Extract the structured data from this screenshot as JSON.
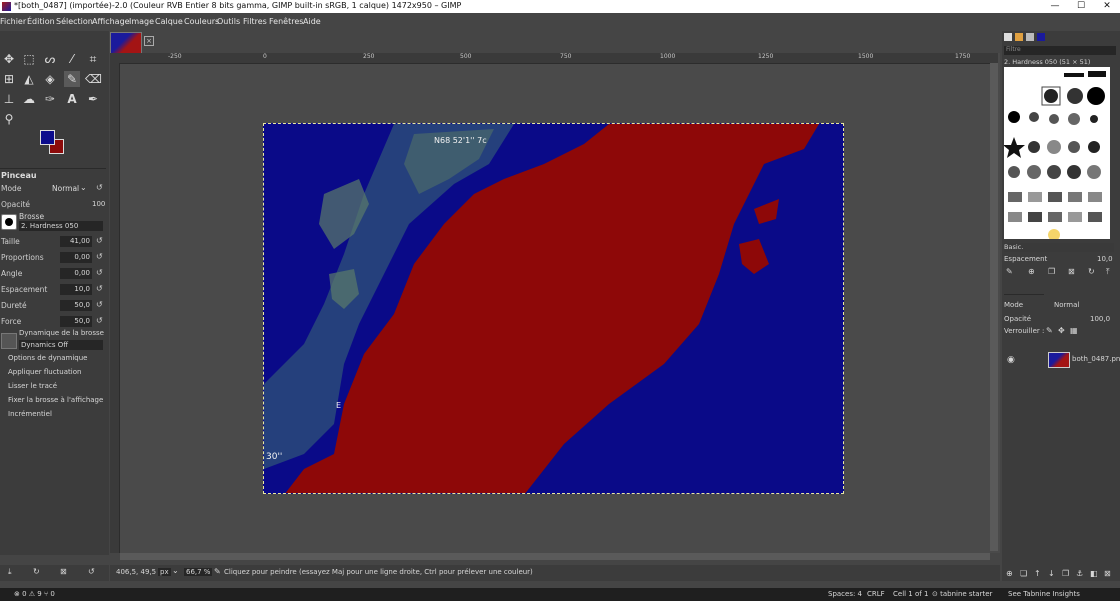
{
  "window": {
    "title": "*[both_0487] (importée)-2.0 (Couleur RVB Entier 8 bits gamma, GIMP built-in sRGB, 1 calque) 1472x950 – GIMP",
    "min": "—",
    "max": "☐",
    "close": "✕"
  },
  "menu": [
    "Fichier",
    "Édition",
    "Sélection",
    "Affichage",
    "Image",
    "Calque",
    "Couleurs",
    "Outils",
    "Filtres",
    "Fenêtres",
    "Aide"
  ],
  "tool_options": {
    "header": "Pinceau",
    "mode_label": "Mode",
    "mode_value": "Normal",
    "opacity_label": "Opacité",
    "opacity_value": "100",
    "brush_label": "Brosse",
    "brush_value": "2. Hardness 050",
    "rows": [
      {
        "label": "Taille",
        "value": "41,00"
      },
      {
        "label": "Proportions",
        "value": "0,00"
      },
      {
        "label": "Angle",
        "value": "0,00"
      },
      {
        "label": "Espacement",
        "value": "10,0"
      },
      {
        "label": "Dureté",
        "value": "50,0"
      },
      {
        "label": "Force",
        "value": "50,0"
      }
    ],
    "dynamics_label": "Dynamique de la brosse",
    "dynamics_value": "Dynamics Off",
    "options": [
      "Options de dynamique",
      "Appliquer fluctuation",
      "Lisser le tracé",
      "Fixer la brosse à l'affichage",
      "Incrémentiel"
    ]
  },
  "ruler": {
    "ticks": [
      "-250",
      "0",
      "250",
      "500",
      "750",
      "1000",
      "1250",
      "1500",
      "1750"
    ]
  },
  "image_overlay": {
    "coord_text": "N68 52'1'' 7c",
    "letter_e": "E",
    "seconds": "30''"
  },
  "status": {
    "coords": "406,5, 49,5",
    "unit": "px",
    "zoom": "66,7 %",
    "message": "Cliquez pour peindre (essayez Maj pour une ligne droite, Ctrl pour prélever une couleur)"
  },
  "right_dock": {
    "filter_placeholder": "Filtre",
    "brush_title": "2. Hardness 050 (51 × 51)",
    "brush_set": "Basic.",
    "spacing_label": "Espacement",
    "spacing_value": "10,0",
    "layers_mode_label": "Mode",
    "layers_mode_value": "Normal",
    "layers_opacity_label": "Opacité",
    "layers_opacity_value": "100,0",
    "lock_label": "Verrouiller :",
    "layer_name": "both_0487.png"
  },
  "vscode": {
    "left": "⊗ 0 ⚠ 9   ⑂ 0",
    "spaces": "Spaces: 4",
    "eol": "CRLF",
    "cell": "Cell 1 of 1",
    "tabnine": "⊙ tabnine starter",
    "insights": "See Tabnine Insights"
  },
  "colors": {
    "fg": "#0c0c8c",
    "bg": "#8c0a0a"
  }
}
